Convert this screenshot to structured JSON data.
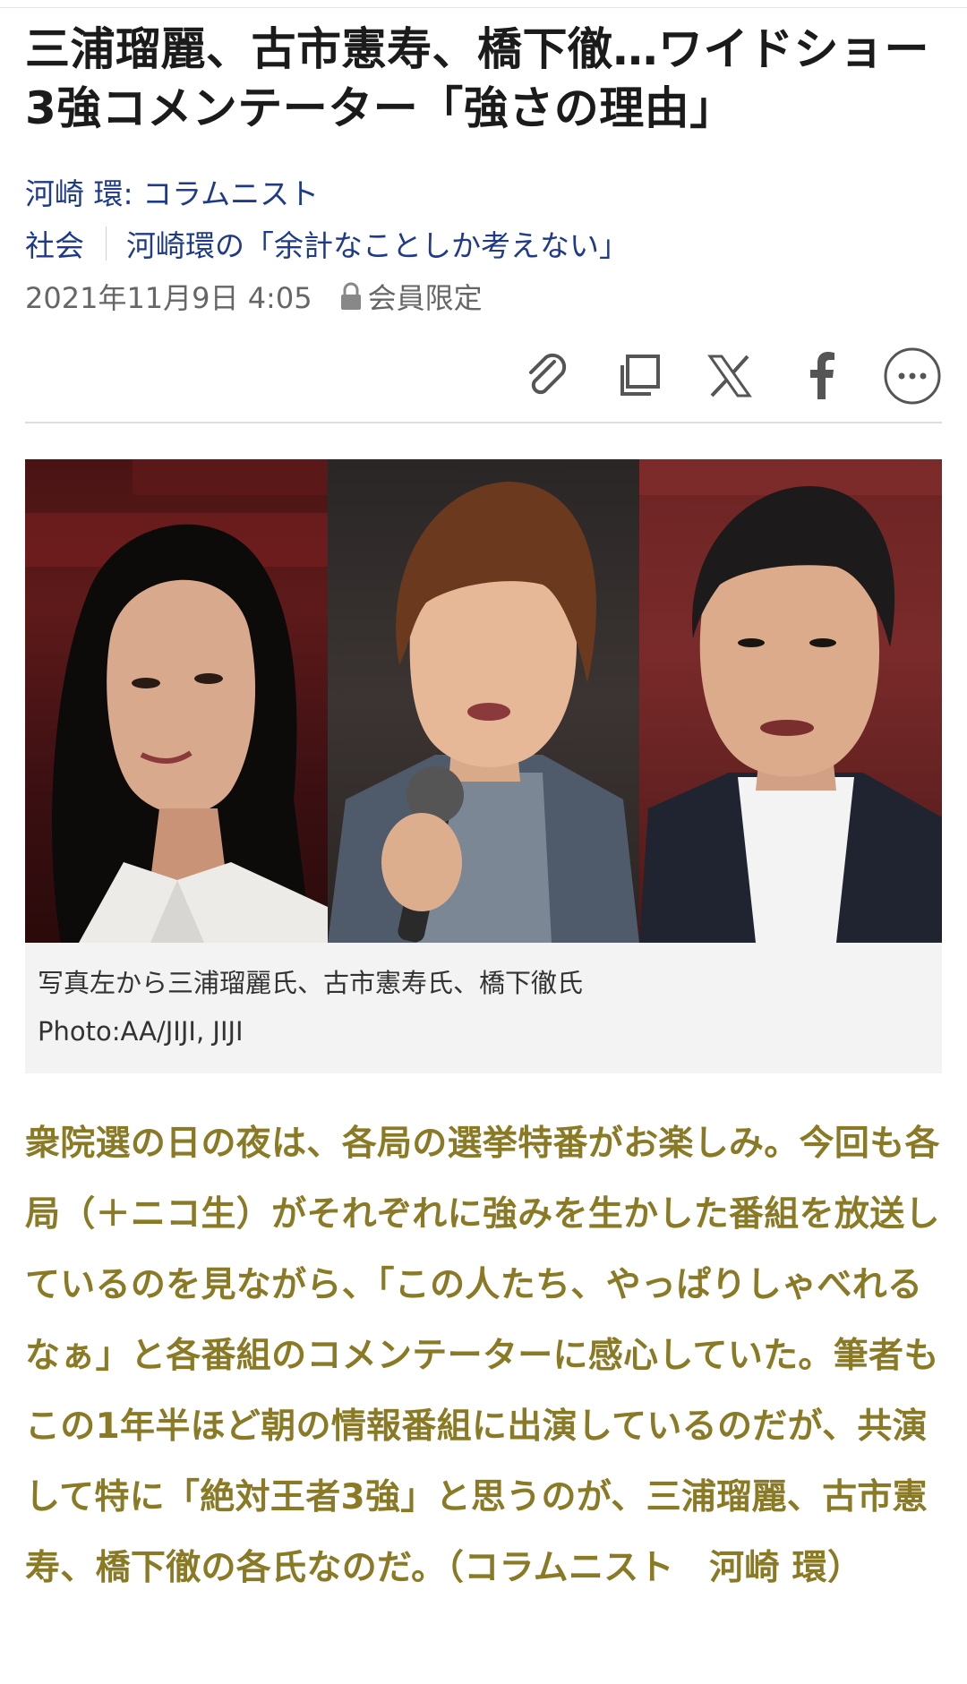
{
  "article": {
    "title": "三浦瑠麗、古市憲寿、橋下徹…ワイドショー3強コメンテーター「強さの理由」",
    "author": "河崎 環: コラムニスト",
    "category": "社会",
    "series": "河崎環の「余計なことしか考えない」",
    "date": "2021年11月9日 4:05",
    "members_only": "会員限定"
  },
  "share": {
    "icons": [
      "paperclip-icon",
      "copy-icon",
      "x-icon",
      "facebook-icon",
      "more-icon"
    ]
  },
  "photo": {
    "caption": "写真左から三浦瑠麗氏、古市憲寿氏、橋下徹氏",
    "credit": "Photo:AA/JIJI, JIJI"
  },
  "lead": "衆院選の日の夜は、各局の選挙特番がお楽しみ。今回も各局（＋ニコ生）がそれぞれに強みを生かした番組を放送しているのを見ながら、「この人たち、やっぱりしゃべれるなぁ」と各番組のコメンテーターに感心していた。筆者もこの1年半ほど朝の情報番組に出演しているのだが、共演して特に「絶対王者3強」と思うのが、三浦瑠麗、古市憲寿、橋下徹の各氏なのだ。（コラムニスト　河崎 環）",
  "colors": {
    "link": "#1f3a8a",
    "lead": "#8a7a26",
    "caption_bg": "#f3f3f3"
  }
}
